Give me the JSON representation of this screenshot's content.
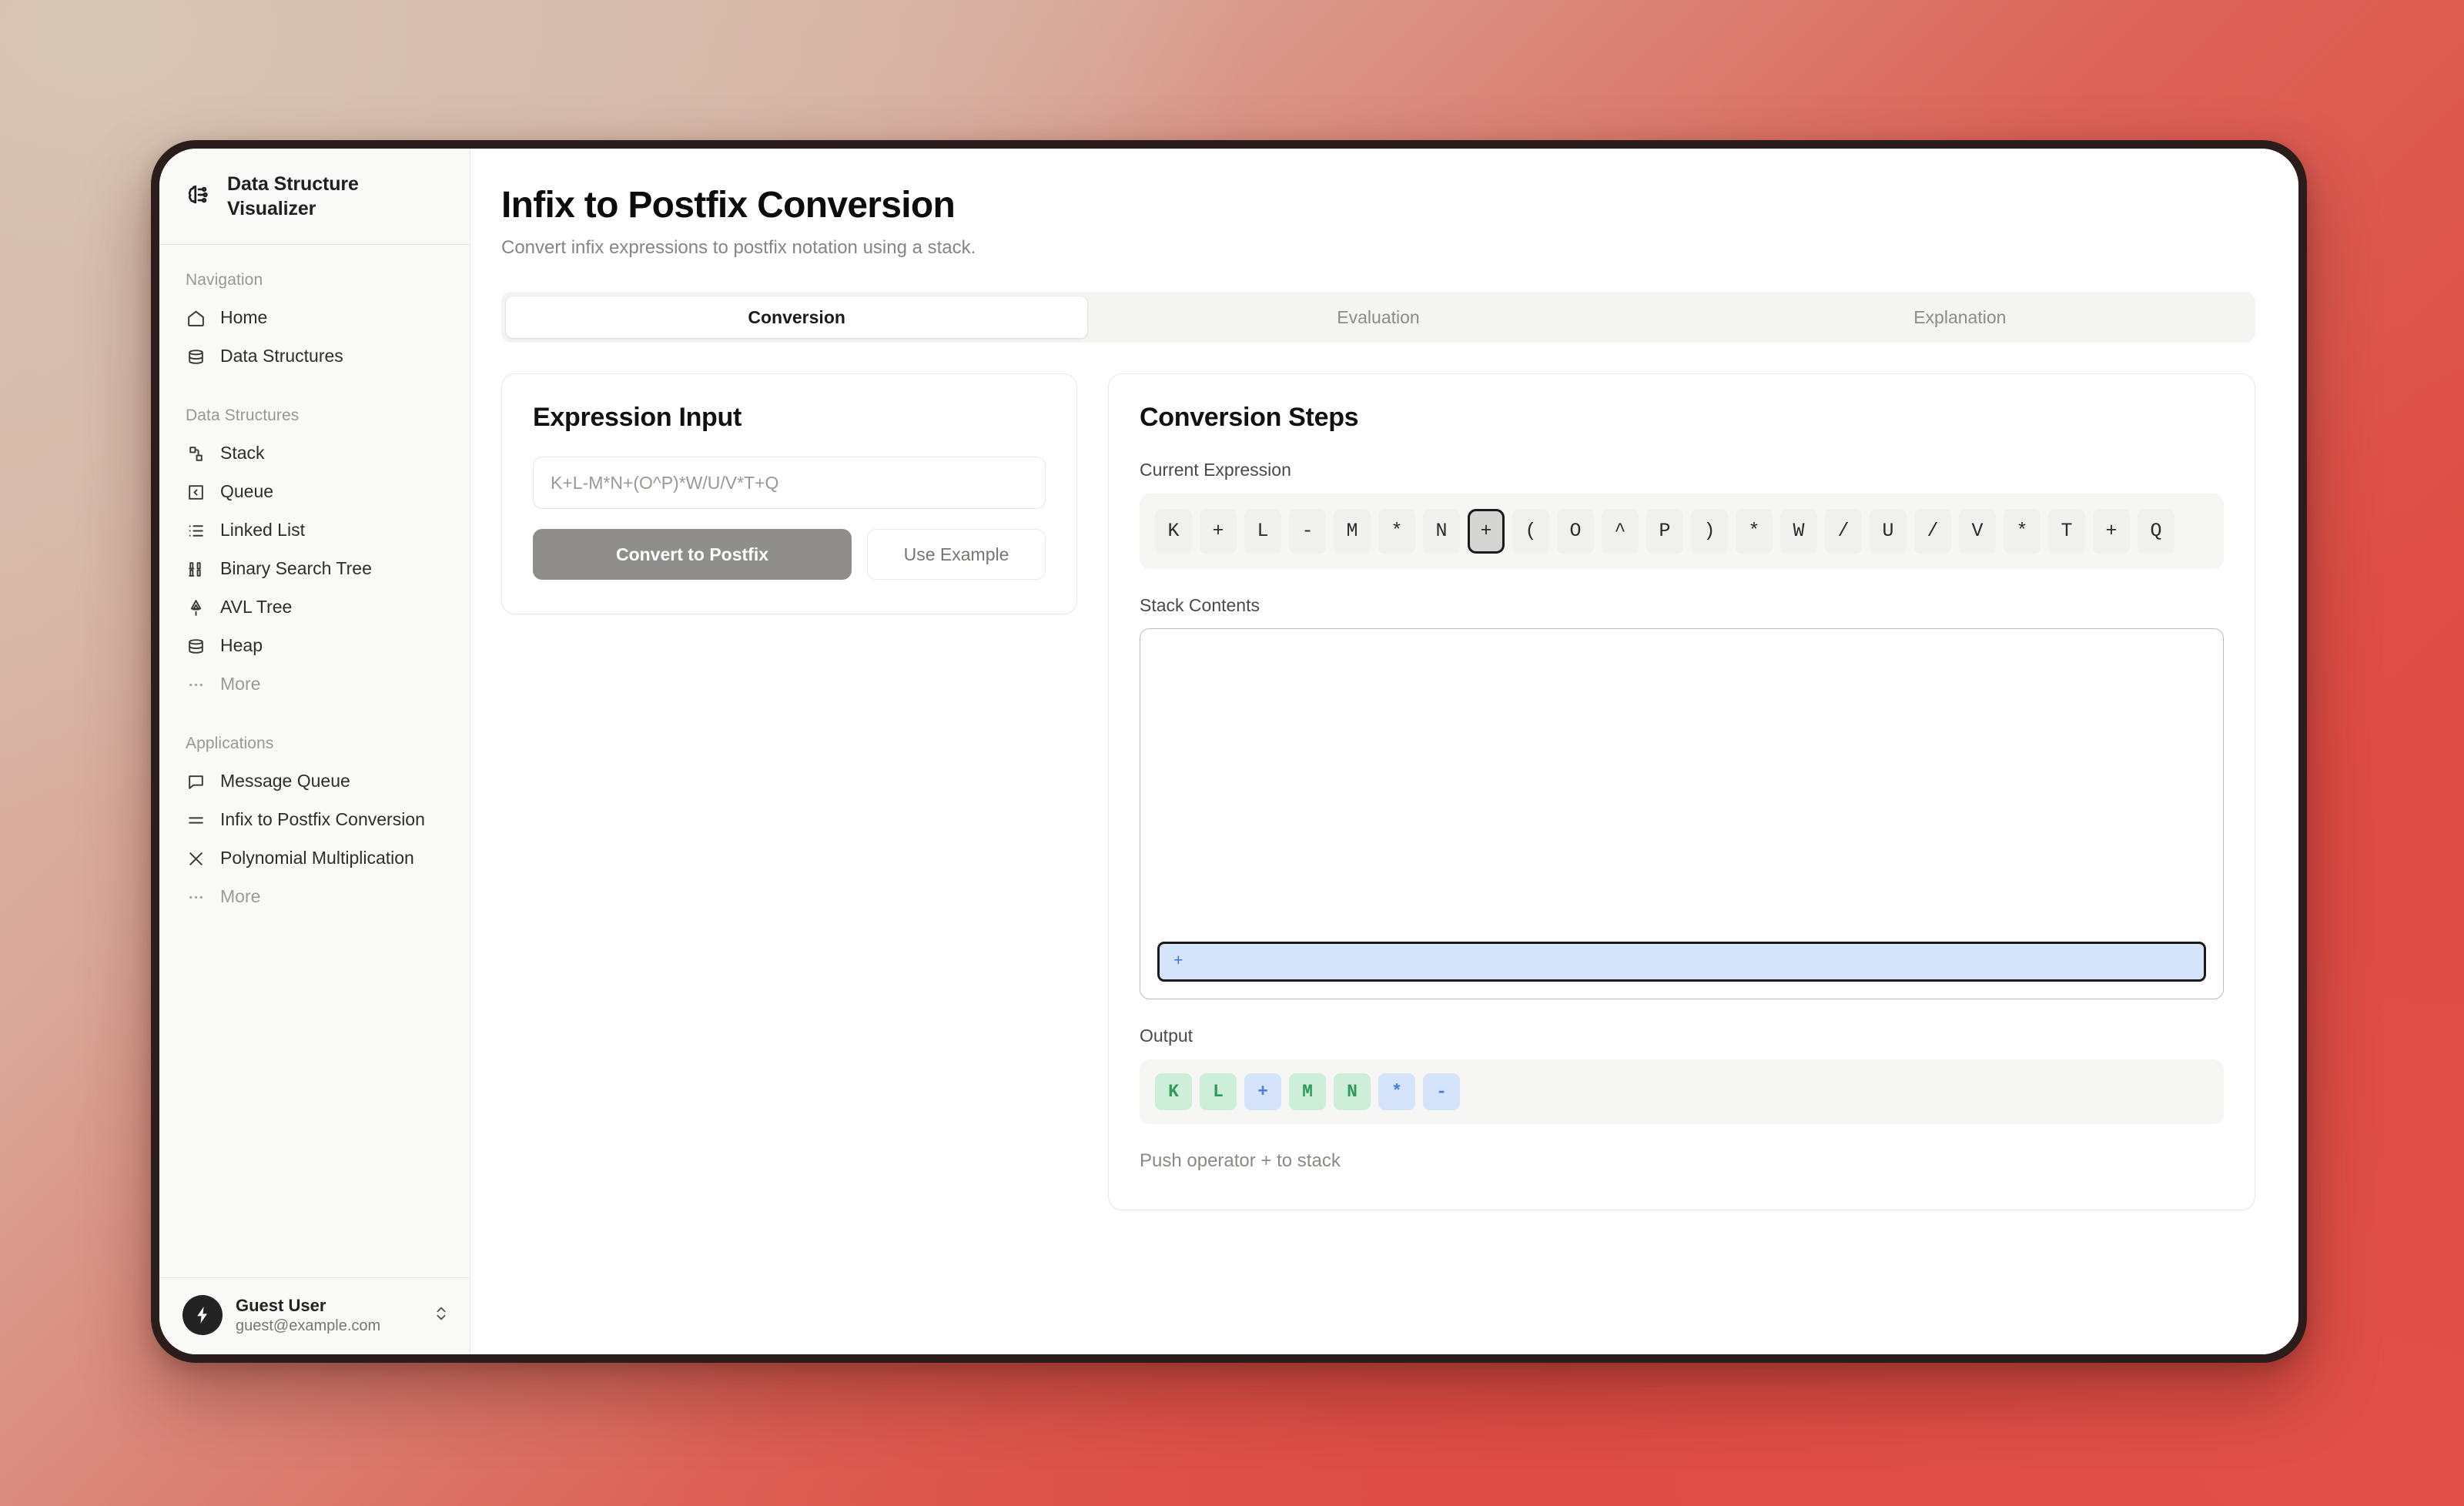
{
  "app": {
    "brand_line1": "Data Structure",
    "brand_line2": "Visualizer",
    "brand_icon": "brain-circuit-icon"
  },
  "sidebar": {
    "groups": [
      {
        "label": "Navigation",
        "items": [
          {
            "label": "Home",
            "icon": "home-icon",
            "muted": false
          },
          {
            "label": "Data Structures",
            "icon": "database-icon",
            "muted": false
          }
        ]
      },
      {
        "label": "Data Structures",
        "items": [
          {
            "label": "Stack",
            "icon": "stack-layers-icon",
            "muted": false
          },
          {
            "label": "Queue",
            "icon": "queue-arrow-icon",
            "muted": false
          },
          {
            "label": "Linked List",
            "icon": "list-icon",
            "muted": false
          },
          {
            "label": "Binary Search Tree",
            "icon": "binary-icon",
            "muted": false
          },
          {
            "label": "AVL Tree",
            "icon": "tree-icon",
            "muted": false
          },
          {
            "label": "Heap",
            "icon": "database-icon",
            "muted": false
          },
          {
            "label": "More",
            "icon": "ellipsis-icon",
            "muted": true
          }
        ]
      },
      {
        "label": "Applications",
        "items": [
          {
            "label": "Message Queue",
            "icon": "message-icon",
            "muted": false
          },
          {
            "label": "Infix to Postfix Conversion",
            "icon": "equals-icon",
            "muted": false
          },
          {
            "label": "Polynomial Multiplication",
            "icon": "x-icon",
            "muted": false
          },
          {
            "label": "More",
            "icon": "ellipsis-icon",
            "muted": true
          }
        ]
      }
    ],
    "footer": {
      "avatar_icon": "lightning-bolt-icon",
      "name": "Guest User",
      "email": "guest@example.com",
      "selector_icon": "chevron-up-down-icon"
    }
  },
  "header": {
    "title": "Infix to Postfix Conversion",
    "subtitle": "Convert infix expressions to postfix notation using a stack."
  },
  "tabs": [
    {
      "label": "Conversion",
      "active": true
    },
    {
      "label": "Evaluation",
      "active": false
    },
    {
      "label": "Explanation",
      "active": false
    }
  ],
  "expression_input": {
    "title": "Expression Input",
    "placeholder": "K+L-M*N+(O^P)*W/U/V*T+Q",
    "value": "",
    "convert_label": "Convert to Postfix",
    "example_label": "Use Example"
  },
  "conversion_steps": {
    "title": "Conversion Steps",
    "current_expression_label": "Current Expression",
    "tokens": [
      {
        "char": "K",
        "current": false
      },
      {
        "char": "+",
        "current": false
      },
      {
        "char": "L",
        "current": false
      },
      {
        "char": "-",
        "current": false
      },
      {
        "char": "M",
        "current": false
      },
      {
        "char": "*",
        "current": false
      },
      {
        "char": "N",
        "current": false
      },
      {
        "char": "+",
        "current": true
      },
      {
        "char": "(",
        "current": false
      },
      {
        "char": "O",
        "current": false
      },
      {
        "char": "^",
        "current": false
      },
      {
        "char": "P",
        "current": false
      },
      {
        "char": ")",
        "current": false
      },
      {
        "char": "*",
        "current": false
      },
      {
        "char": "W",
        "current": false
      },
      {
        "char": "/",
        "current": false
      },
      {
        "char": "U",
        "current": false
      },
      {
        "char": "/",
        "current": false
      },
      {
        "char": "V",
        "current": false
      },
      {
        "char": "*",
        "current": false
      },
      {
        "char": "T",
        "current": false
      },
      {
        "char": "+",
        "current": false
      },
      {
        "char": "Q",
        "current": false
      }
    ],
    "stack_label": "Stack Contents",
    "stack": [
      {
        "char": "+"
      }
    ],
    "output_label": "Output",
    "output": [
      {
        "char": "K",
        "kind": "operand"
      },
      {
        "char": "L",
        "kind": "operand"
      },
      {
        "char": "+",
        "kind": "operator"
      },
      {
        "char": "M",
        "kind": "operand"
      },
      {
        "char": "N",
        "kind": "operand"
      },
      {
        "char": "*",
        "kind": "operator"
      },
      {
        "char": "-",
        "kind": "operator"
      }
    ],
    "status": "Push operator + to stack"
  },
  "colors": {
    "accent_operand": "#2f9a5c",
    "accent_operator": "#4a7fe0",
    "operand_bg": "#cdeed8",
    "operator_bg": "#d6e4fb",
    "primary_button": "#908e8c"
  }
}
